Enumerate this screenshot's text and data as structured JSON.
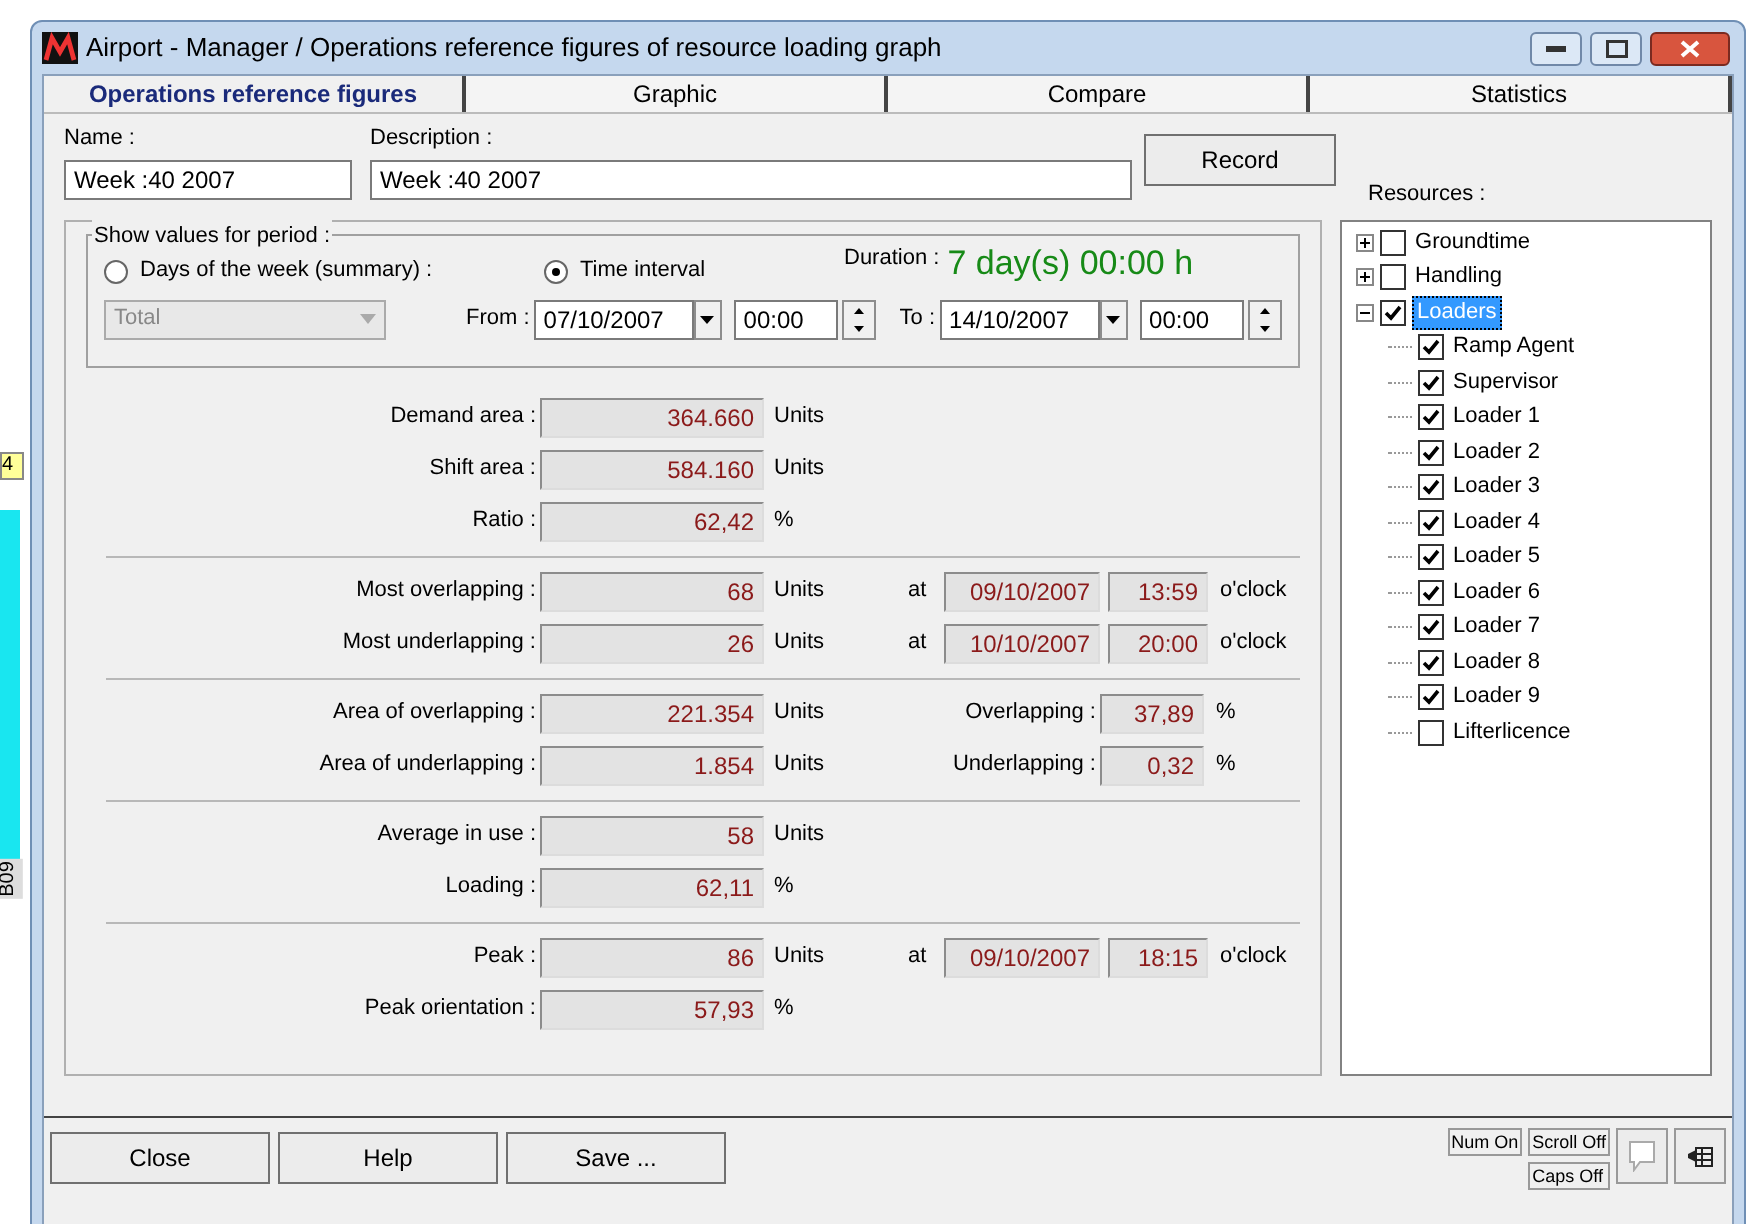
{
  "background": {
    "texts": [
      {
        "label": "4",
        "kind": "tag"
      },
      {
        "label": "B09",
        "kind": "vertical"
      }
    ]
  },
  "window": {
    "title": "Airport - Manager / Operations reference figures of resource loading graph"
  },
  "tabs": [
    {
      "label": "Operations reference figures",
      "selected": true
    },
    {
      "label": "Graphic",
      "selected": false
    },
    {
      "label": "Compare",
      "selected": false
    },
    {
      "label": "Statistics",
      "selected": false
    }
  ],
  "name_field": {
    "label": "Name :",
    "value": "Week :40 2007"
  },
  "description_field": {
    "label": "Description :",
    "value": "Week :40 2007"
  },
  "record_button": "Record",
  "period": {
    "title": "Show values for period :",
    "options": [
      {
        "label": "Days of the week (summary) :",
        "selected": false
      },
      {
        "label": "Time interval",
        "selected": true
      }
    ],
    "dropdown": {
      "value": "Total",
      "disabled": true
    },
    "duration_label": "Duration :",
    "duration": "7 day(s) 00:00 h",
    "from": {
      "label": "From :",
      "date": "07/10/2007",
      "time": "00:00"
    },
    "to": {
      "label": "To :",
      "date": "14/10/2007",
      "time": "00:00"
    }
  },
  "sections": [
    [
      {
        "label": "Demand area :",
        "value": "364.660",
        "unit": "Units"
      },
      {
        "label": "Shift area :",
        "value": "584.160",
        "unit": "Units"
      },
      {
        "label": "Ratio :",
        "value": "62,42",
        "unit": "%"
      }
    ],
    [
      {
        "label": "Most overlapping :",
        "value": "68",
        "unit": "Units",
        "extra": {
          "kind": "at",
          "label": "at",
          "date": "09/10/2007",
          "time": "13:59",
          "suffix": "o'clock"
        }
      },
      {
        "label": "Most underlapping :",
        "value": "26",
        "unit": "Units",
        "extra": {
          "kind": "at",
          "label": "at",
          "date": "10/10/2007",
          "time": "20:00",
          "suffix": "o'clock"
        }
      }
    ],
    [
      {
        "label": "Area of overlapping :",
        "value": "221.354",
        "unit": "Units",
        "extra": {
          "kind": "percent",
          "label": "Overlapping :",
          "value": "37,89",
          "unit": "%"
        }
      },
      {
        "label": "Area of underlapping :",
        "value": "1.854",
        "unit": "Units",
        "extra": {
          "kind": "percent",
          "label": "Underlapping :",
          "value": "0,32",
          "unit": "%"
        }
      }
    ],
    [
      {
        "label": "Average in use :",
        "value": "58",
        "unit": "Units"
      },
      {
        "label": "Loading :",
        "value": "62,11",
        "unit": "%"
      }
    ],
    [
      {
        "label": "Peak :",
        "value": "86",
        "unit": "Units",
        "extra": {
          "kind": "at",
          "label": "at",
          "date": "09/10/2007",
          "time": "18:15",
          "suffix": "o'clock"
        }
      },
      {
        "label": "Peak orientation :",
        "value": "57,93",
        "unit": "%"
      }
    ]
  ],
  "resources": {
    "label": "Resources :",
    "items": [
      {
        "label": "Groundtime",
        "checked": false,
        "expanded": false,
        "selected": false
      },
      {
        "label": "Handling",
        "checked": false,
        "expanded": false,
        "selected": false
      },
      {
        "label": "Loaders",
        "checked": true,
        "expanded": true,
        "selected": true,
        "children": [
          {
            "label": "Ramp Agent",
            "checked": true,
            "selected": false
          },
          {
            "label": "Supervisor",
            "checked": true,
            "selected": false
          },
          {
            "label": "Loader 1",
            "checked": true,
            "selected": false
          },
          {
            "label": "Loader 2",
            "checked": true,
            "selected": false
          },
          {
            "label": "Loader 3",
            "checked": true,
            "selected": false
          },
          {
            "label": "Loader 4",
            "checked": true,
            "selected": false
          },
          {
            "label": "Loader 5",
            "checked": true,
            "selected": false
          },
          {
            "label": "Loader 6",
            "checked": true,
            "selected": false
          },
          {
            "label": "Loader 7",
            "checked": true,
            "selected": false
          },
          {
            "label": "Loader 8",
            "checked": true,
            "selected": false
          },
          {
            "label": "Loader 9",
            "checked": true,
            "selected": false
          },
          {
            "label": "Lifterlicence",
            "checked": false,
            "selected": false
          }
        ]
      }
    ]
  },
  "buttons": [
    "Close",
    "Help",
    "Save ..."
  ],
  "status": {
    "num": "Num On",
    "scroll": "Scroll Off",
    "caps": "Caps Off"
  }
}
